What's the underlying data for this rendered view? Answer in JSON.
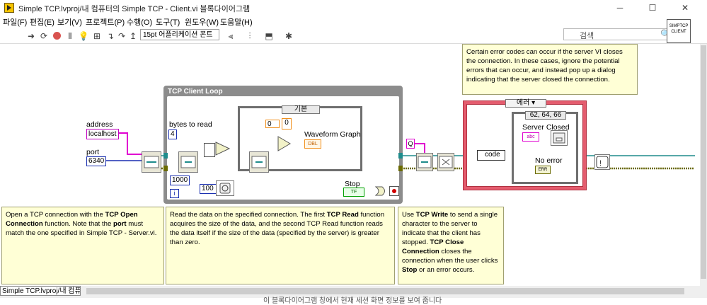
{
  "window": {
    "title": "Simple TCP.lvproj/내 컴퓨터의 Simple TCP - Client.vi 블록다이어그램",
    "minimize": "─",
    "maximize": "☐",
    "close": "✕"
  },
  "menu": [
    "파일(F)",
    "편집(E)",
    "보기(V)",
    "프로젝트(P)",
    "수행(O)",
    "도구(T)",
    "윈도우(W)",
    "도움말(H)"
  ],
  "toolbar": {
    "font": "15pt 어플리케이션 폰트",
    "search_placeholder": "검색",
    "vi_icon_text": "SIMPTCP CLIENT"
  },
  "diagram": {
    "address_label": "address",
    "address_value": "localhost",
    "port_label": "port",
    "port_value": "6340",
    "loop_title": "TCP Client Loop",
    "bytes_label": "bytes to read",
    "bytes_value": "4",
    "timeout_value": "1000",
    "wait_value": "100",
    "iteration": "i",
    "case_default": "기본",
    "index_0": "0",
    "index_value": "0",
    "waveform_label": "Waveform Graph",
    "stop_label": "Stop",
    "q_const": "Q",
    "error_case": "에러",
    "error_codes": "62, 64, 66",
    "server_closed_label": "Server Closed",
    "code_label": "code",
    "no_error_label": "No error",
    "notes": {
      "top_right": "Certain error codes can occur if the server VI closes the connection. In these cases, ignore the potential errors that can occur, and instead pop up a dialog indicating that the server closed the connection.",
      "left_pre": "Open a TCP connection with the ",
      "left_b1": "TCP Open Connection",
      "left_mid": " function. Note that the ",
      "left_b2": "port",
      "left_post": " must match the one specified in Simple TCP - Server.vi.",
      "mid_pre": "Read the data on the specified connection. The first ",
      "mid_b1": "TCP Read",
      "mid_post": " function acquires the size of the data, and the second TCP Read function reads the data itself if the size of the data (specified by the server) is greater than zero.",
      "right_pre": "Use ",
      "right_b1": "TCP Write",
      "right_mid": " to send a single character to the server to indicate that the client has stopped. ",
      "right_b2": "TCP Close Connection",
      "right_mid2": " closes the connection when the user clicks ",
      "right_b3": "Stop",
      "right_post": " or an error occurs."
    }
  },
  "bottom_tab": "Simple TCP.lvproj/내 컴퓨터",
  "bottom_text": "이 블록다이어그램 창에서 현재 세션 화면 정보를 보여 줍니다"
}
